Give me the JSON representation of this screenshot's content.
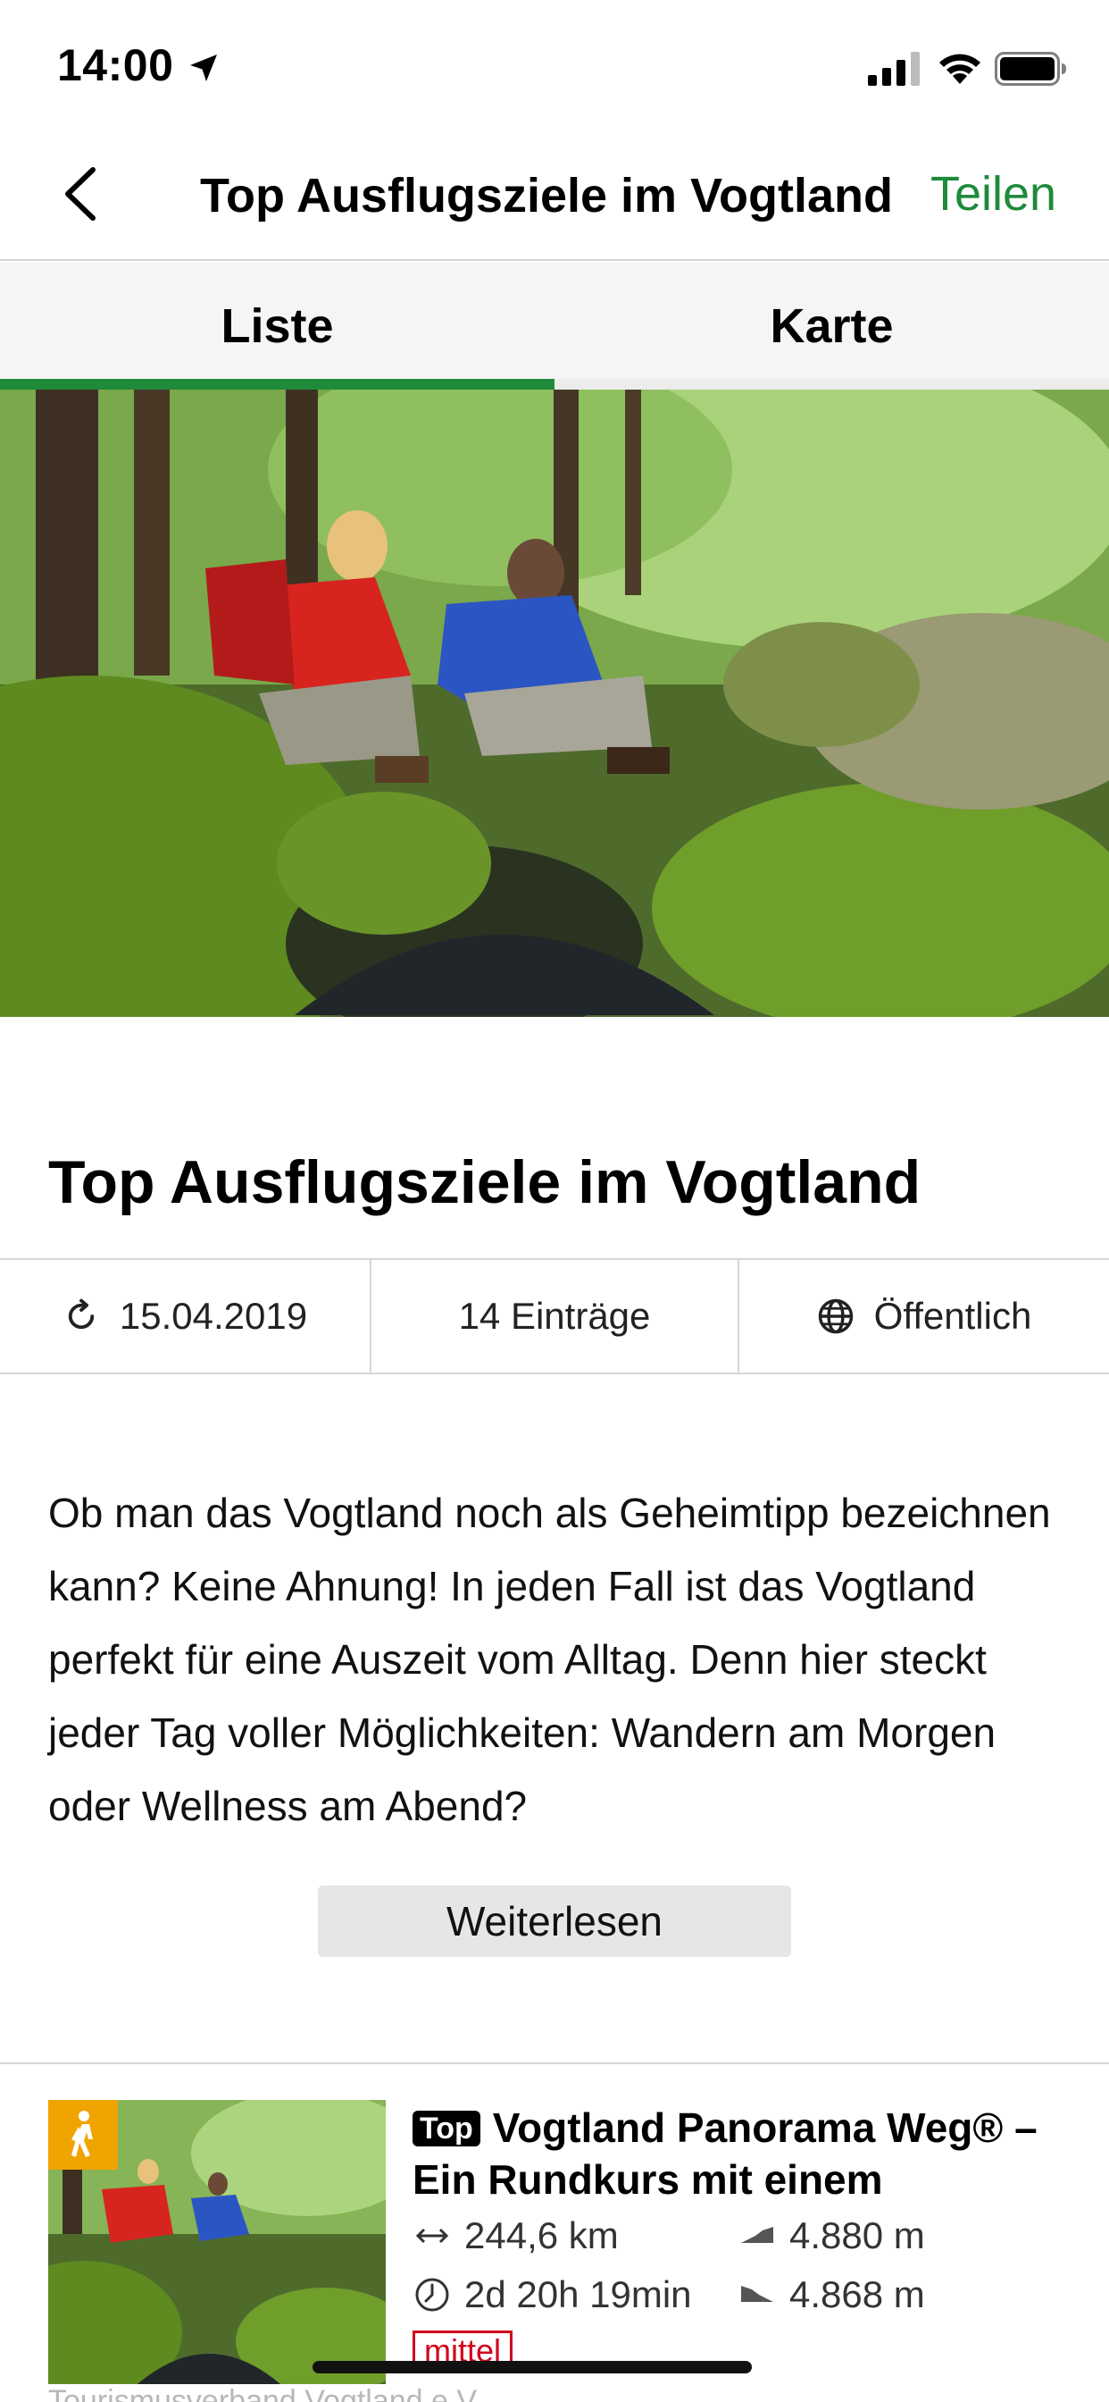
{
  "status_bar": {
    "time": "14:00"
  },
  "nav": {
    "title": "Top Ausflugsziele im Vogtland",
    "share_label": "Teilen"
  },
  "tabs": [
    {
      "label": "Liste",
      "active": true
    },
    {
      "label": "Karte",
      "active": false
    }
  ],
  "hero": {
    "image": "hikers-at-mossy-creek"
  },
  "page_title": "Top Ausflugsziele im Vogtland",
  "meta": {
    "updated": "15.04.2019",
    "entries": "14 Einträge",
    "visibility": "Öffentlich"
  },
  "description": "Ob man das Vogtland noch als Geheimtipp bezeichnen kann? Keine Ahnung! In jeden Fall ist das Vogtland perfekt für eine Auszeit vom Alltag. Denn hier steckt jeder Tag voller Möglichkeiten: Wandern am Morgen oder Wellness am Abend?",
  "read_more_label": "Weiterlesen",
  "entry": {
    "badge": "Top",
    "title": "Vogtland Panorama Weg® – Ein Rundkurs mit einem",
    "distance": "244,6 km",
    "ascent": "4.880 m",
    "duration": "2d 20h 19min",
    "descent": "4.868 m",
    "difficulty": "mittel",
    "subtitle": "Tourismusverband Vogtland e.V.",
    "accent_colors": {
      "hike_badge": "#f0a400",
      "difficulty": "#d0021b"
    }
  },
  "colors": {
    "accent": "#1f8a3a"
  }
}
